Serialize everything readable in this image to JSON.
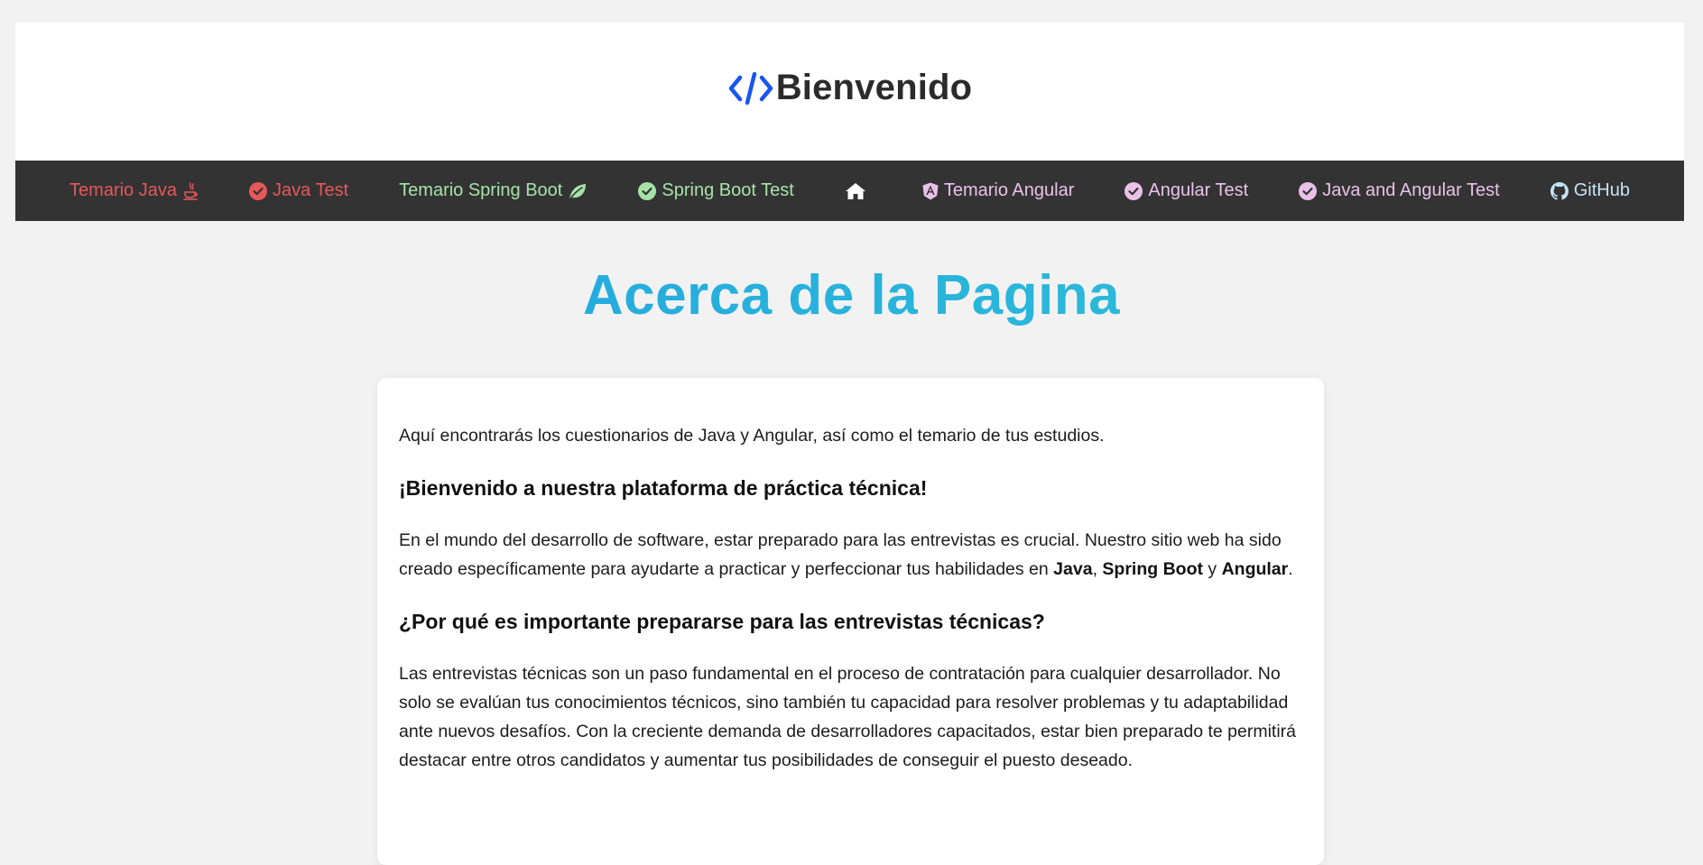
{
  "header": {
    "title": "Bienvenido",
    "logo_icon": "code-brackets-icon",
    "logo_color": "#1a56f0"
  },
  "nav": {
    "items": [
      {
        "label": "Temario Java",
        "icon": "java-cup-icon",
        "color": "#e8575a"
      },
      {
        "label": "Java Test",
        "icon": "check-circle-icon",
        "color": "#e8575a"
      },
      {
        "label": "Temario Spring Boot",
        "icon": "leaf-icon",
        "color": "#a6e3a8"
      },
      {
        "label": "Spring Boot Test",
        "icon": "check-circle-icon",
        "color": "#a6e3a8"
      },
      {
        "label": "",
        "icon": "home-icon",
        "color": "#ffffff"
      },
      {
        "label": "Temario Angular",
        "icon": "angular-shield-icon",
        "color": "#e9c1e8"
      },
      {
        "label": "Angular Test",
        "icon": "check-circle-icon",
        "color": "#e9c1e8"
      },
      {
        "label": "Java and Angular Test",
        "icon": "check-circle-icon",
        "color": "#e9c1e8"
      },
      {
        "label": "GitHub",
        "icon": "github-icon",
        "color": "#c6e2f6"
      }
    ]
  },
  "main": {
    "title": "Acerca de la Pagina",
    "intro": "Aquí encontrarás los cuestionarios de Java y Angular, así como el temario de tus estudios.",
    "welcome_heading": "¡Bienvenido a nuestra plataforma de práctica técnica!",
    "world_text_1": "En el mundo del desarrollo de software, estar preparado para las entrevistas es crucial. Nuestro sitio web ha sido creado específicamente para ayudarte a practicar y perfeccionar tus habilidades en ",
    "world_bold_java": "Java",
    "world_sep_1": ", ",
    "world_bold_spring": "Spring Boot",
    "world_sep_2": " y ",
    "world_bold_angular": "Angular",
    "world_end": ".",
    "why_heading": "¿Por qué es importante prepararse para las entrevistas técnicas?",
    "why_text": "Las entrevistas técnicas son un paso fundamental en el proceso de contratación para cualquier desarrollador. No solo se evalúan tus conocimientos técnicos, sino también tu capacidad para resolver problemas y tu adaptabilidad ante nuevos desafíos. Con la creciente demanda de desarrolladores capacitados, estar bien preparado te permitirá destacar entre otros candidatos y aumentar tus posibilidades de conseguir el puesto deseado."
  }
}
